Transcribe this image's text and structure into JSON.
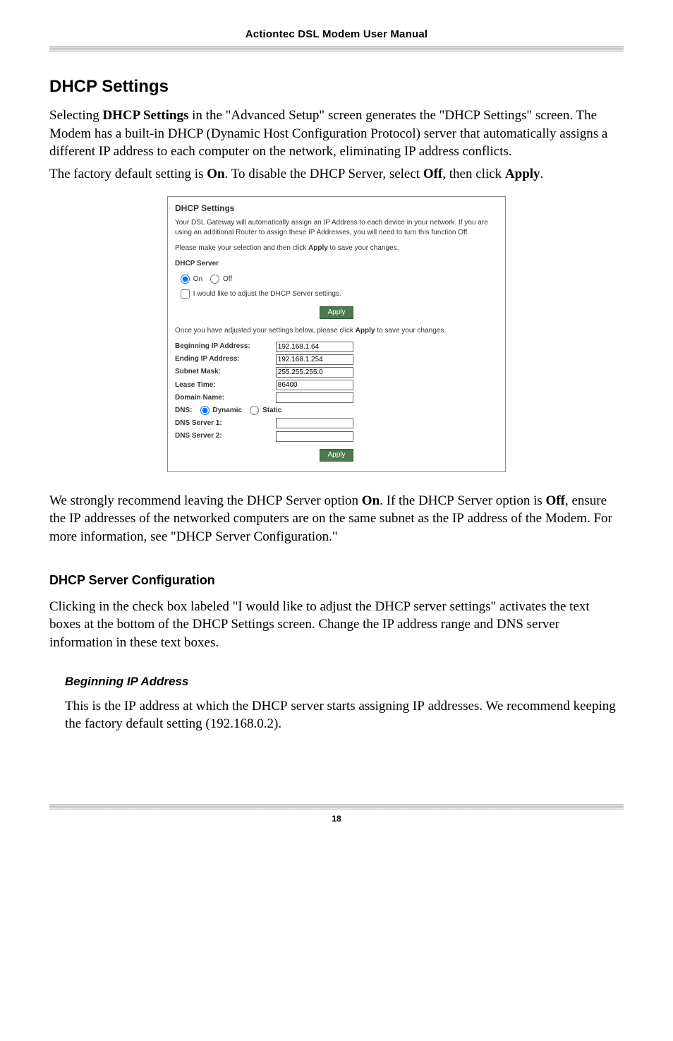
{
  "header": {
    "title": "Actiontec DSL Modem User Manual"
  },
  "h2": "DHCP Settings",
  "intro_html": "Selecting <b>DHCP Settings</b> in the \"Advanced Setup\" screen generates the \"DHCP Settings\" screen. The Modem has a built-in DHCP (Dynamic Host Configuration Protocol) server that automatically assigns a different IP address to each computer on the network, eliminating IP address conflicts.",
  "intro2_html": "The factory default setting is <b>On</b>. To disable the DHCP Server, select <b>Off</b>, then click <b>Apply</b>.",
  "embed": {
    "heading": "DHCP Settings",
    "para1": "Your DSL Gateway will automatically assign an IP Address to each device in your network. If you are using an additional Router to assign these IP Addresses, you will need to turn this function Off.",
    "para2_html": "Please make your selection and then click <b>Apply</b> to save your changes.",
    "server_label": "DHCP Server",
    "on_label": "On",
    "off_label": "Off",
    "adjust_label": "I would like to adjust the DHCP Server settings.",
    "apply_label": "Apply",
    "note_html": "Once you have adjusted your settings below, please click <b>Apply</b> to save your changes.",
    "rows": {
      "beginning_ip_label": "Beginning IP Address:",
      "beginning_ip_value": "192.168.1.64",
      "ending_ip_label": "Ending IP Address:",
      "ending_ip_value": "192.168.1.254",
      "subnet_label": "Subnet Mask:",
      "subnet_value": "255.255.255.0",
      "lease_label": "Lease Time:",
      "lease_value": "86400",
      "domain_label": "Domain Name:",
      "domain_value": "",
      "dns_prefix": "DNS:",
      "dns_dynamic": "Dynamic",
      "dns_static": "Static",
      "dns1_label": "DNS Server 1:",
      "dns1_value": "",
      "dns2_label": "DNS Server 2:",
      "dns2_value": ""
    }
  },
  "post_embed_html": "We strongly recommend leaving the <span style='font-variant:small-caps'>DHCP</span> Server option <b>On</b>. If the <span style='font-variant:small-caps'>DHCP</span> Server option is <b>Off</b>, ensure the <span style='font-variant:small-caps'>IP</span> addresses of the networked computers are on the same subnet as the <span style='font-variant:small-caps'>IP</span> address of the Modem. For more information, see \"<span style='font-variant:small-caps'>DHCP</span> Server Configuration.\"",
  "h3": "DHCP Server Configuration",
  "h3_body": "Clicking in the check box labeled \"I would like to adjust the DHCP server settings\" activates the text boxes at the bottom of the DHCP Settings screen. Change the IP address range and DNS server information in these text boxes.",
  "h4": "Beginning IP Address",
  "h4_body_html": "This is the <span style='font-variant:small-caps'>IP</span> address at which the <span style='font-variant:small-caps'>DHCP</span> server starts assigning <span style='font-variant:small-caps'>IP</span> addresses. We recommend keeping the factory default setting (192.168.0.2).",
  "page_number": "18"
}
